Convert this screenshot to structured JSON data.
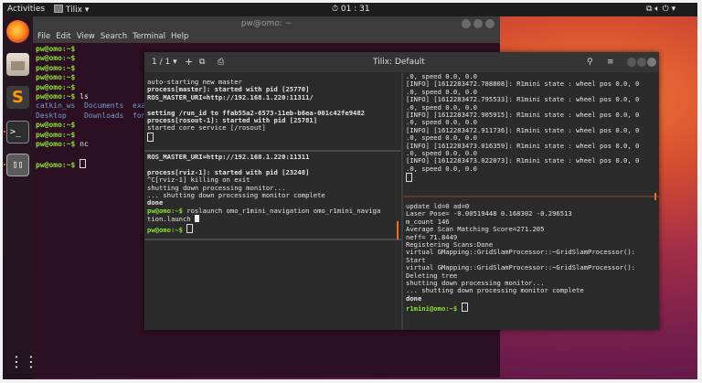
{
  "topbar": {
    "activities": "Activities",
    "app_name": "Tilix",
    "clock": "01 : 31"
  },
  "dock": {
    "items": [
      "firefox-icon",
      "files-icon",
      "sublime-icon",
      "terminal-icon",
      "tilix-icon",
      "show-apps-icon"
    ]
  },
  "background_terminal": {
    "title": "pw@omo: ~",
    "menu": [
      "File",
      "Edit",
      "View",
      "Search",
      "Terminal",
      "Help"
    ],
    "lines": [
      {
        "prompt": "pw@omo:~$",
        "text": ""
      },
      {
        "prompt": "pw@omo:~$",
        "text": ""
      },
      {
        "prompt": "pw@omo:~$",
        "text": ""
      },
      {
        "prompt": "pw@omo:~$",
        "text": ""
      },
      {
        "prompt": "pw@omo:~$",
        "text": ""
      },
      {
        "prompt": "pw@omo:~$",
        "text": " ls"
      }
    ],
    "ls_row1": [
      "catkin_ws",
      "Documents",
      "exa"
    ],
    "ls_row2": [
      "Desktop",
      "Downloads",
      "fon"
    ],
    "after_lines": [
      {
        "prompt": "pw@omo:~$",
        "text": ""
      },
      {
        "prompt": "pw@omo:~$",
        "text": ""
      },
      {
        "prompt": "pw@omo:~$",
        "text": " nc"
      },
      {
        "prompt": "",
        "text": ""
      },
      {
        "prompt": "pw@omo:~$",
        "text": " "
      }
    ]
  },
  "tilix": {
    "session_indicator": "1 / 1",
    "title": "Tilix: Default",
    "pane_top_left": [
      {
        "t": "auto-starting new master",
        "b": false
      },
      {
        "t": "process[master]: started with pid [25770]",
        "b": true
      },
      {
        "t": "ROS_MASTER_URI=http://192.168.1.220:11311/",
        "b": true
      },
      {
        "t": "",
        "b": false
      },
      {
        "t": "setting /run_id to ffab55a2-6573-11eb-b6ea-001c42fe9482",
        "b": true
      },
      {
        "t": "process[rosout-1]: started with pid [25781]",
        "b": true
      },
      {
        "t": "started core service [/rosout]",
        "b": false
      }
    ],
    "pane_bottom_left": [
      {
        "t": "",
        "b": false
      },
      {
        "t": "ROS_MASTER_URI=http://192.168.1.220:11311",
        "b": true
      },
      {
        "t": "",
        "b": false
      },
      {
        "t": "process[rviz-1]: started with pid [23248]",
        "b": true
      },
      {
        "t": "^C[rviz-1] killing on exit",
        "b": false
      },
      {
        "t": "shutting down processing monitor...",
        "b": false
      },
      {
        "t": "... shutting down processing monitor complete",
        "b": false
      },
      {
        "t": "done",
        "b": true
      }
    ],
    "bottom_left_cmd_prompt": "pw@omo:~$",
    "bottom_left_cmd": " roslaunch omo_r1mini_navigation omo_r1mini_naviga",
    "bottom_left_cmd_wrap": "tion.launch ",
    "bottom_left_final_prompt": "pw@omo:~$",
    "pane_top_right": [
      ".0, speed 0.0, 0.0",
      "[INFO] [1612283472.788808]: R1mini state : wheel pos 0.0, 0",
      ".0, speed 0.0, 0.0",
      "[INFO] [1612283472.795533]: R1mini state : wheel pos 0.0, 0",
      ".0, speed 0.0, 0.0",
      "[INFO] [1612283472.905915]: R1mini state : wheel pos 0.0, 0",
      ".0, speed 0.0, 0.0",
      "[INFO] [1612283472.911736]: R1mini state : wheel pos 0.0, 0",
      ".0, speed 0.0, 0.0",
      "[INFO] [1612283473.016359]: R1mini state : wheel pos 0.0, 0",
      ".0, speed 0.0, 0.0",
      "[INFO] [1612283473.022073]: R1mini state : wheel pos 0.0, 0",
      ".0, speed 0.0, 0.0"
    ],
    "pane_bottom_right": [
      {
        "t": "update ld=0 ad=0",
        "b": false
      },
      {
        "t": "Laser Pose= -0.00519448 0.168302 -0.296513",
        "b": false
      },
      {
        "t": "m_count 146",
        "b": false
      },
      {
        "t": "Average Scan Matching Score=271.205",
        "b": false
      },
      {
        "t": "neff= 71.8449",
        "b": false
      },
      {
        "t": "Registering Scans:Done",
        "b": false
      },
      {
        "t": "virtual GMapping::GridSlamProcessor::~GridSlamProcessor():",
        "b": false
      },
      {
        "t": "Start",
        "b": false
      },
      {
        "t": "virtual GMapping::GridSlamProcessor::~GridSlamProcessor():",
        "b": false
      },
      {
        "t": "Deleting tree",
        "b": false
      },
      {
        "t": "shutting down processing monitor...",
        "b": false
      },
      {
        "t": "... shutting down processing monitor complete",
        "b": false
      },
      {
        "t": "done",
        "b": true
      }
    ],
    "bottom_right_prompt": "r1mini@omo:~$"
  },
  "colors": {
    "prompt_green": "#8ae234",
    "dir_blue": "#729fcf",
    "splitter_orange": "#e8702a"
  }
}
